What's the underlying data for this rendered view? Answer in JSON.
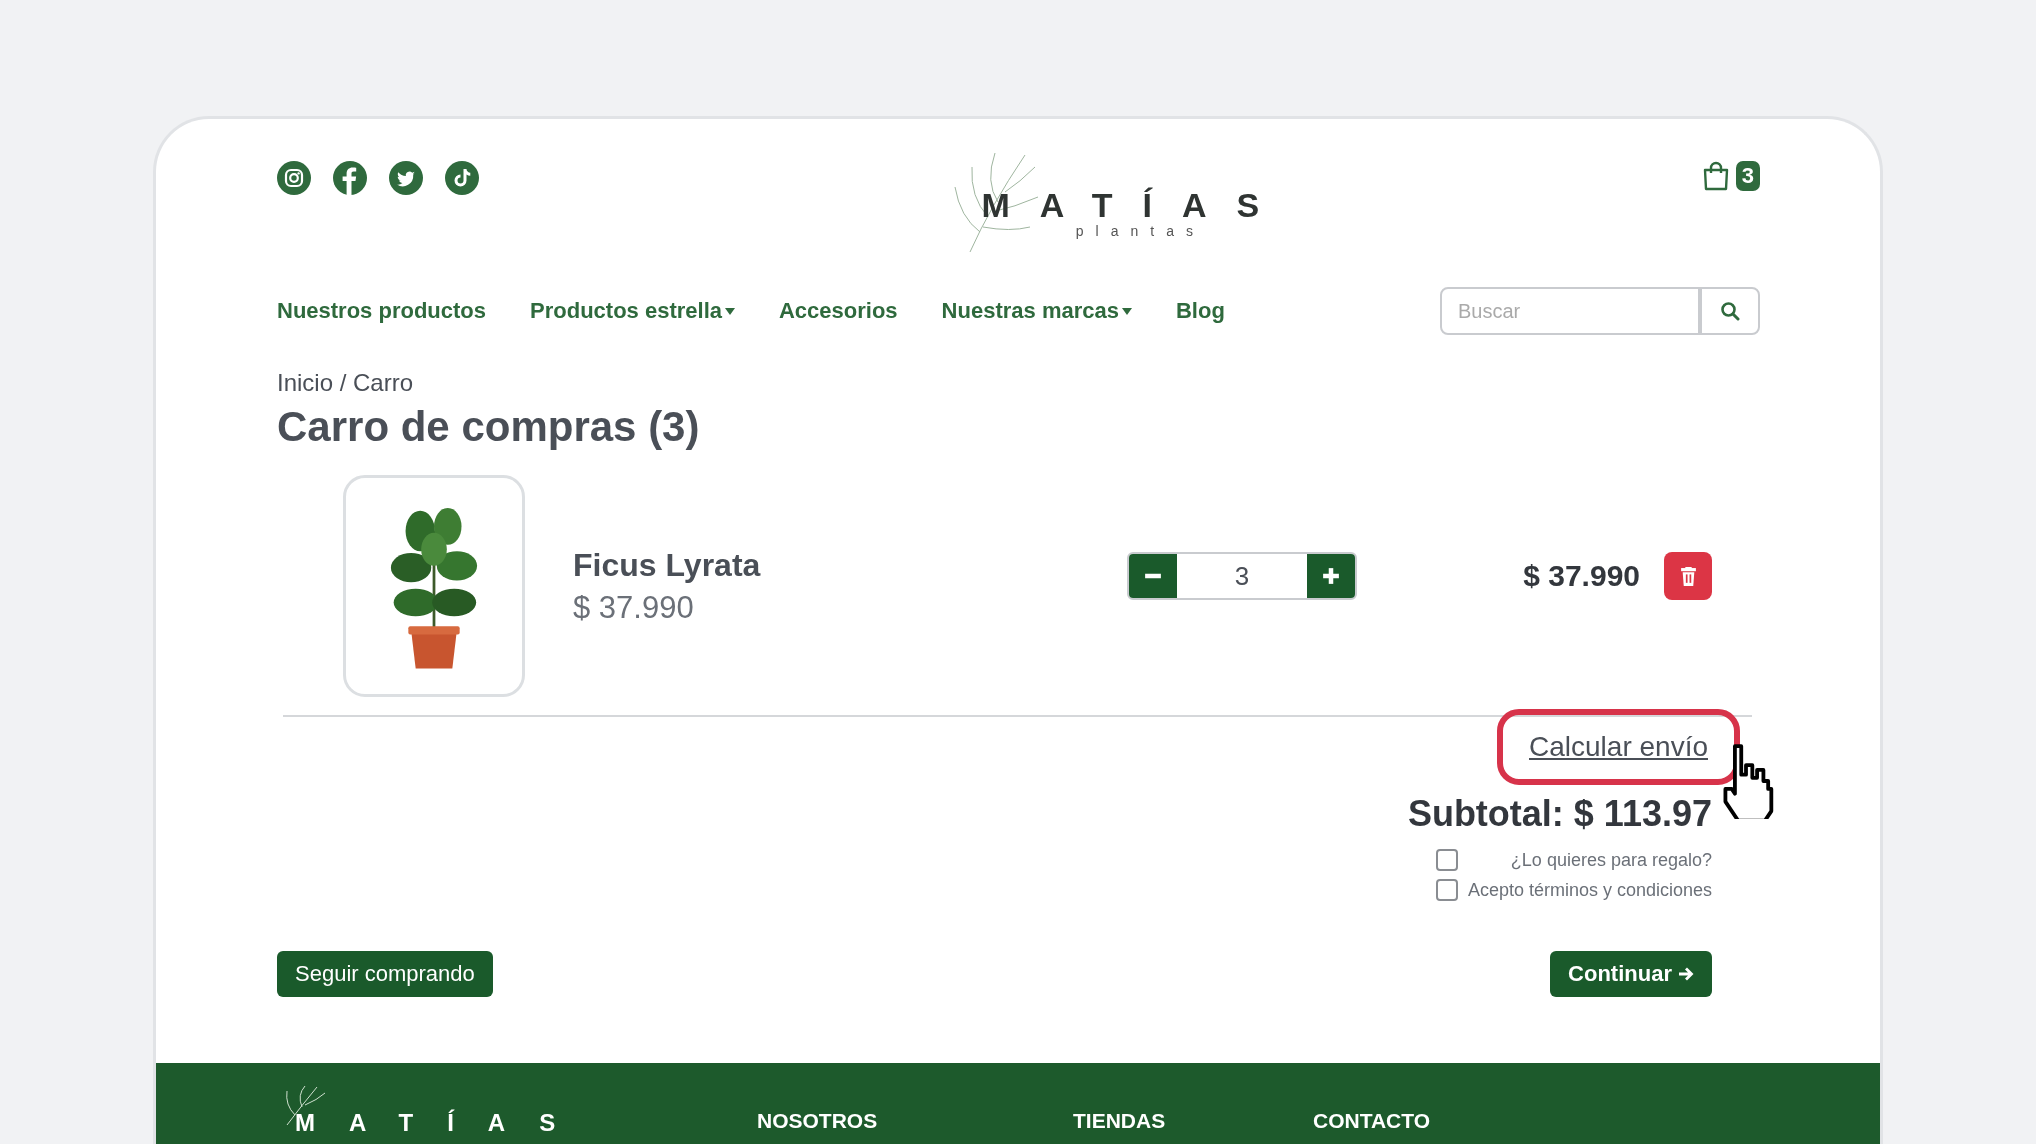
{
  "header": {
    "logo": {
      "title": "MATÍAS",
      "subtitle": "plantas"
    },
    "cart_count": "3"
  },
  "nav": [
    {
      "label": "Nuestros productos",
      "dropdown": false
    },
    {
      "label": "Productos estrella",
      "dropdown": true
    },
    {
      "label": "Accesorios",
      "dropdown": false
    },
    {
      "label": "Nuestras marcas",
      "dropdown": true
    },
    {
      "label": "Blog",
      "dropdown": false
    }
  ],
  "search": {
    "placeholder": "Buscar"
  },
  "breadcrumb": "Inicio / Carro",
  "title": "Carro de compras (3)",
  "cart_items": [
    {
      "name": "Ficus Lyrata",
      "unit_price": "$ 37.990",
      "quantity": "3",
      "total": "$ 37.990"
    }
  ],
  "shipping_link": {
    "label": "Calcular envío",
    "highlighted": true
  },
  "subtotal": "Subtotal: $ 113.97",
  "options": [
    {
      "label": "¿Lo quieres para regalo?",
      "checked": false
    },
    {
      "label": "Acepto términos y condiciones",
      "checked": false
    }
  ],
  "buttons": {
    "back": "Seguir comprando",
    "continue": "Continuar"
  },
  "footer": {
    "logo_title": "MATÍAS",
    "headings": [
      "NOSOTROS",
      "TIENDAS",
      "CONTACTO"
    ]
  }
}
